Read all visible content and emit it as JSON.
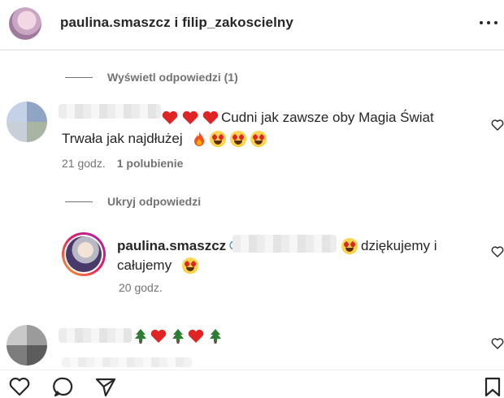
{
  "header": {
    "title": "paulina.smaszcz i filip_zakoscielny",
    "avatar": "avatar",
    "more_icon": "more-options-icon"
  },
  "toggles": {
    "show_replies": "Wyświetl odpowiedzi (1)",
    "hide_replies": "Ukryj odpowiedzi"
  },
  "comments": [
    {
      "line1": "Cudni jak zawsze oby Magia Świat",
      "line2": "Trwała jak najdłużej",
      "time": "21 godz.",
      "likes": "1 polubienie",
      "emojis": [
        "heart",
        "heart",
        "heart",
        "fire",
        "heart-eyes",
        "heart-eyes",
        "heart-eyes"
      ]
    },
    {
      "author": "paulina.smaszcz",
      "line1": "dziękujemy i",
      "line2": "całujemy",
      "time": "20 godz.",
      "emojis": [
        "heart-eyes",
        "heart-eyes"
      ]
    },
    {
      "emojis": [
        "christmas-tree",
        "heart",
        "christmas-tree",
        "heart",
        "christmas-tree"
      ]
    }
  ],
  "actions": [
    "like-icon",
    "comment-icon",
    "share-icon",
    "save-icon"
  ],
  "colors": {
    "text": "#262626",
    "muted": "#737373",
    "heart": "#e02424",
    "border": "#dbdbdb"
  }
}
